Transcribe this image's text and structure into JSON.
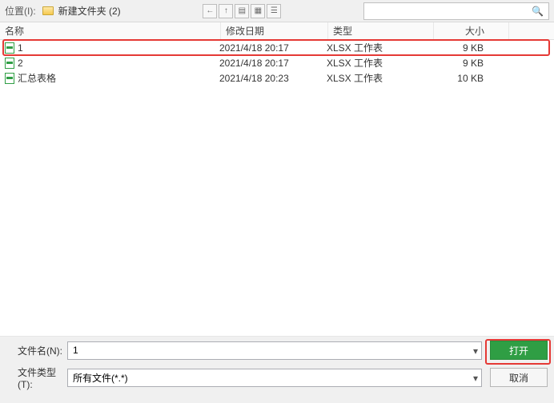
{
  "location": {
    "label": "位置(I):",
    "folder_name": "新建文件夹 (2)"
  },
  "columns": {
    "name": "名称",
    "date": "修改日期",
    "type": "类型",
    "size": "大小"
  },
  "files": [
    {
      "name": "1",
      "date": "2021/4/18 20:17",
      "type": "XLSX 工作表",
      "size": "9 KB"
    },
    {
      "name": "2",
      "date": "2021/4/18 20:17",
      "type": "XLSX 工作表",
      "size": "9 KB"
    },
    {
      "name": "汇总表格",
      "date": "2021/4/18 20:23",
      "type": "XLSX 工作表",
      "size": "10 KB"
    }
  ],
  "form": {
    "filename_label": "文件名(N):",
    "filename_value": "1",
    "filetype_label": "文件类型(T):",
    "filetype_value": "所有文件(*.*)"
  },
  "buttons": {
    "open": "打开",
    "cancel": "取消"
  }
}
